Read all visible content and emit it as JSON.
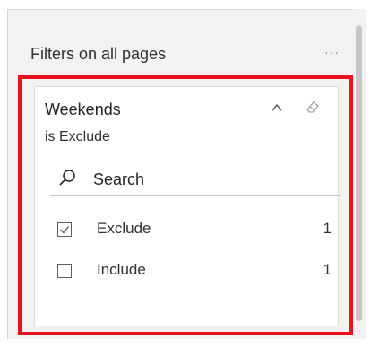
{
  "filter_pane": {
    "title": "Filters on all pages",
    "more_icon": "ellipsis-icon"
  },
  "filter_card": {
    "title": "Weekends",
    "subtitle": "is Exclude",
    "icons": {
      "collapse": "chevron-up-icon",
      "clear": "eraser-icon",
      "search": "search-icon"
    },
    "search": {
      "placeholder": "Search"
    },
    "items": [
      {
        "label": "Exclude",
        "count": "1",
        "checked": true
      },
      {
        "label": "Include",
        "count": "1",
        "checked": false
      }
    ]
  },
  "colors": {
    "highlight": "#e8121e",
    "pane_background": "#f3f2f1",
    "card_background": "#ffffff"
  }
}
